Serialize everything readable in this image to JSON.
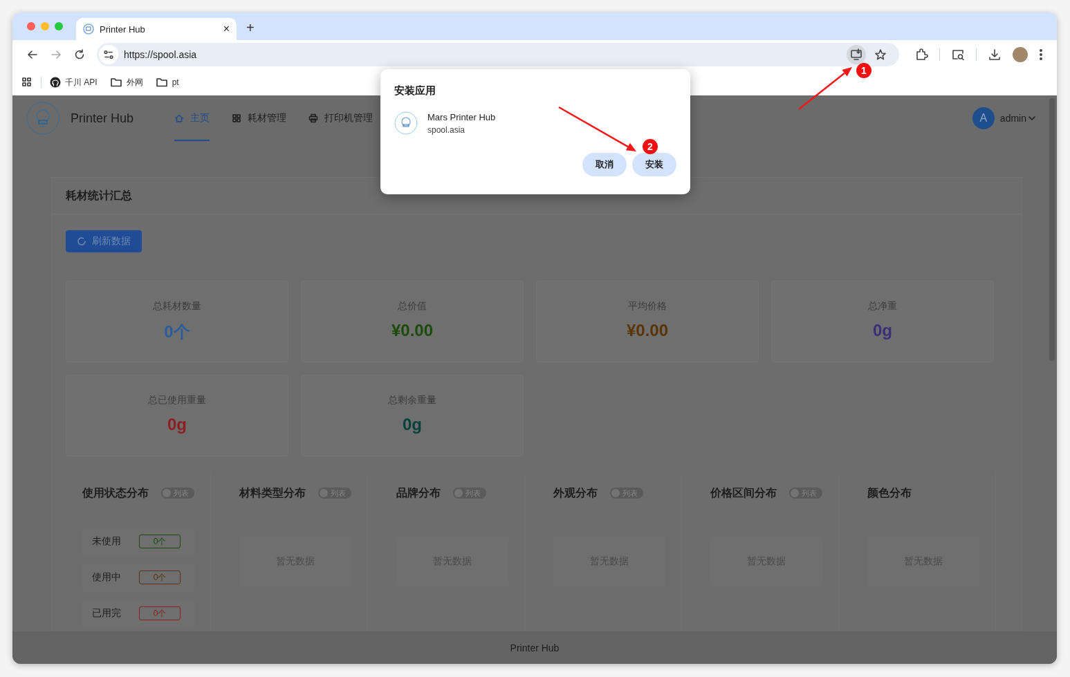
{
  "browser": {
    "tab": {
      "title": "Printer Hub",
      "close": "×"
    },
    "new_tab": "+",
    "url": "https://spool.asia",
    "bookmarks": [
      {
        "kind": "github",
        "label": "千川 API"
      },
      {
        "kind": "folder",
        "label": "外网"
      },
      {
        "kind": "folder",
        "label": "pt"
      }
    ]
  },
  "app": {
    "brand": "Printer Hub",
    "nav": [
      {
        "label": "主页",
        "selected": true
      },
      {
        "label": "耗材管理",
        "selected": false
      },
      {
        "label": "打印机管理",
        "selected": false
      }
    ],
    "user": {
      "initial": "A",
      "name": "admin"
    }
  },
  "summary": {
    "title": "耗材统计汇总",
    "refresh": "刷新数据",
    "stats": [
      {
        "label": "总耗材数量",
        "value": "0个",
        "color": "#2b5c9a"
      },
      {
        "label": "总价值",
        "value": "¥0.00",
        "color": "#1c4a0a"
      },
      {
        "label": "平均价格",
        "value": "¥0.00",
        "color": "#5a3406"
      },
      {
        "label": "总净重",
        "value": "0g",
        "color": "#3a2f78"
      },
      {
        "label": "总已使用重量",
        "value": "0g",
        "color": "#8c1f22"
      },
      {
        "label": "总剩余重量",
        "value": "0g",
        "color": "#08403c"
      }
    ]
  },
  "distributions": [
    {
      "title": "使用状态分布",
      "kind": "list",
      "toggle": {
        "label": "列表",
        "on": false
      },
      "rows": [
        {
          "label": "未使用",
          "count": "0个",
          "color": "#1c4a0a"
        },
        {
          "label": "使用中",
          "count": "0个",
          "color": "#5a3406"
        },
        {
          "label": "已用完",
          "count": "0个",
          "color": "#8c1f22"
        }
      ]
    },
    {
      "title": "材料类型分布",
      "kind": "empty",
      "toggle": {
        "label": "列表",
        "on": false
      },
      "empty": "暂无数据"
    },
    {
      "title": "品牌分布",
      "kind": "empty",
      "toggle": {
        "label": "列表",
        "on": false
      },
      "empty": "暂无数据"
    },
    {
      "title": "外观分布",
      "kind": "empty",
      "toggle": {
        "label": "列表",
        "on": false
      },
      "empty": "暂无数据"
    },
    {
      "title": "价格区间分布",
      "kind": "empty",
      "toggle": {
        "label": "列表",
        "on": false
      },
      "empty": "暂无数据"
    },
    {
      "title": "颜色分布",
      "kind": "empty",
      "empty": "暂无数据"
    }
  ],
  "footer": "Printer Hub",
  "dialog": {
    "title": "安装应用",
    "app_name": "Mars Printer Hub",
    "app_url": "spool.asia",
    "buttons": [
      "取消",
      "安装"
    ]
  },
  "annotations": [
    {
      "kind": "toolbar",
      "label": "1"
    },
    {
      "kind": "dialog",
      "label": "2"
    }
  ]
}
